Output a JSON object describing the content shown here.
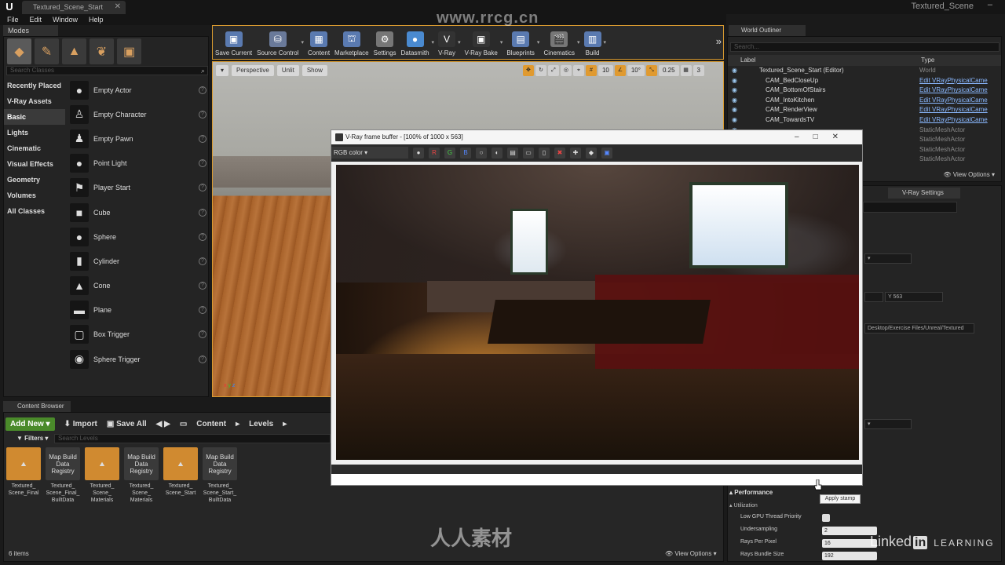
{
  "title_bar": {
    "doc_tab": "Textured_Scene_Start",
    "project": "Textured_Scene"
  },
  "menu": [
    "File",
    "Edit",
    "Window",
    "Help"
  ],
  "modes": {
    "tab": "Modes",
    "search_placeholder": "Search Classes",
    "categories": [
      "Recently Placed",
      "V-Ray Assets",
      "Basic",
      "Lights",
      "Cinematic",
      "Visual Effects",
      "Geometry",
      "Volumes",
      "All Classes"
    ],
    "active_category": "Basic",
    "classes": [
      "Empty Actor",
      "Empty Character",
      "Empty Pawn",
      "Point Light",
      "Player Start",
      "Cube",
      "Sphere",
      "Cylinder",
      "Cone",
      "Plane",
      "Box Trigger",
      "Sphere Trigger"
    ]
  },
  "toolbar": [
    {
      "label": "Save Current",
      "icon": "save-icon",
      "color": "#5a7ab0"
    },
    {
      "label": "Source Control",
      "icon": "source-control-icon",
      "color": "#6a7a9a"
    },
    {
      "label": "Content",
      "icon": "content-icon",
      "color": "#5a7ab0"
    },
    {
      "label": "Marketplace",
      "icon": "marketplace-icon",
      "color": "#5a7ab0"
    },
    {
      "label": "Settings",
      "icon": "settings-icon",
      "color": "#777"
    },
    {
      "label": "Datasmith",
      "icon": "datasmith-icon",
      "color": "#4a8ad0"
    },
    {
      "label": "V-Ray",
      "icon": "vray-icon",
      "color": "#333"
    },
    {
      "label": "V-Ray Bake",
      "icon": "vray-bake-icon",
      "color": "#333"
    },
    {
      "label": "Blueprints",
      "icon": "blueprints-icon",
      "color": "#5a7ab0"
    },
    {
      "label": "Cinematics",
      "icon": "cinematics-icon",
      "color": "#777"
    },
    {
      "label": "Build",
      "icon": "build-icon",
      "color": "#5a7ab0"
    }
  ],
  "viewport": {
    "perspective": "Perspective",
    "lit": "Unlit",
    "show": "Show",
    "grid_angle": "10°",
    "camera_speed": "0.25",
    "camera_num": "3"
  },
  "content_browser": {
    "tab": "Content Browser",
    "add_new": "Add New",
    "import": "Import",
    "save_all": "Save All",
    "path": [
      "Content",
      "Levels"
    ],
    "filters": "Filters",
    "search_placeholder": "Search Levels",
    "assets": [
      {
        "name": "Textured_ Scene_Final",
        "type": "map",
        "thumb": ""
      },
      {
        "name": "Textured_ Scene_Final_ BuiltData",
        "type": "reg",
        "thumb": "Map Build Data Registry"
      },
      {
        "name": "Textured_ Scene_ Materials",
        "type": "map",
        "thumb": ""
      },
      {
        "name": "Textured_ Scene_ Materials",
        "type": "reg",
        "thumb": "Map Build Data Registry"
      },
      {
        "name": "Textured_ Scene_Start",
        "type": "map",
        "thumb": ""
      },
      {
        "name": "Textured_ Scene_Start_ BuiltData",
        "type": "reg",
        "thumb": "Map Build Data Registry"
      }
    ],
    "item_count": "6 items",
    "view_options": "View Options"
  },
  "world_outliner": {
    "tab": "World Outliner",
    "search_placeholder": "Search...",
    "col_label": "Label",
    "col_type": "Type",
    "rows": [
      {
        "label": "Textured_Scene_Start (Editor)",
        "type": "World",
        "link": false
      },
      {
        "label": "CAM_BedCloseUp",
        "type": "Edit VRayPhysicalCame",
        "link": true
      },
      {
        "label": "CAM_BottomOfStairs",
        "type": "Edit VRayPhysicalCame",
        "link": true
      },
      {
        "label": "CAM_IntoKitchen",
        "type": "Edit VRayPhysicalCame",
        "link": true
      },
      {
        "label": "CAM_RenderView",
        "type": "Edit VRayPhysicalCame",
        "link": true
      },
      {
        "label": "CAM_TowardsTV",
        "type": "Edit VRayPhysicalCame",
        "link": true
      },
      {
        "label": "",
        "type": "StaticMeshActor",
        "link": false
      },
      {
        "label": "",
        "type": "StaticMeshActor",
        "link": false
      },
      {
        "label": "",
        "type": "StaticMeshActor",
        "link": false
      },
      {
        "label": "",
        "type": "StaticMeshActor",
        "link": false
      }
    ],
    "view_options": "View Options"
  },
  "details": {
    "vray_tab": "V-Ray Settings",
    "y_label": "Y",
    "y_value": "563",
    "path_value": "Desktop/Exercise Files/Unreal/Textured",
    "performance": "Performance",
    "utilization": "Utilization",
    "rows": [
      {
        "label": "Low GPU Thread Priority",
        "value": null
      },
      {
        "label": "Undersampling",
        "value": "2"
      },
      {
        "label": "Rays Per Pixel",
        "value": "16"
      },
      {
        "label": "Rays Bundle Size",
        "value": "192"
      }
    ]
  },
  "vfb": {
    "title": "V-Ray frame buffer - [100% of 1000 x 563]",
    "channel": "RGB color",
    "tooltip": "Apply stamp"
  },
  "watermarks": {
    "top": "www.rrcg.cn",
    "bottom": "人人素材",
    "linkedin_1": "Linked",
    "linkedin_2": "in",
    "linkedin_3": "LEARNING"
  }
}
